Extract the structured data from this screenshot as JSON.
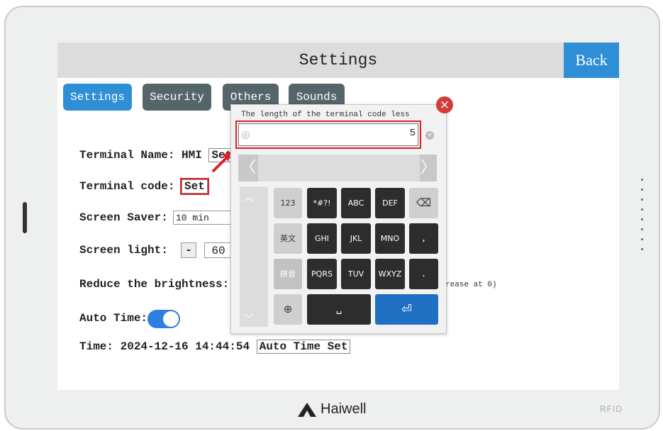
{
  "header": {
    "title": "Settings",
    "back_label": "Back"
  },
  "tabs": [
    {
      "label": "Settings"
    },
    {
      "label": "Security"
    },
    {
      "label": "Others"
    },
    {
      "label": "Sounds"
    }
  ],
  "form": {
    "terminal_name_label": "Terminal Name: HMI",
    "terminal_name_btn": "Set",
    "terminal_code_label": "Terminal code:",
    "terminal_code_btn": "Set",
    "screen_saver_label": "Screen Saver:",
    "screen_saver_value": "10 min",
    "screen_light_label": "Screen light:",
    "minus_label": "-",
    "screen_light_value": "60",
    "reduce_label": "Reduce the brightness:",
    "reduce_hint": "rease at 0)",
    "auto_time_label": "Auto Time:",
    "auto_time_on": true,
    "time_label": "Time: 2024-12-16 14:44:54",
    "auto_time_set_btn": "Auto Time Set"
  },
  "keyboard": {
    "hint": "The length of the terminal code less",
    "close_icon": "×",
    "eye_icon": "◎",
    "input_value": "5",
    "clear_icon": "×",
    "prev_icon": "〈",
    "next_icon": "〉",
    "scroll_up_icon": "︿",
    "scroll_down_icon": "﹀",
    "keys": {
      "k123": "123",
      "sym": "*#?!",
      "abc": "ABC",
      "def": "DEF",
      "backspace": "⌫",
      "lang": "英文",
      "ghi": "GHI",
      "jkl": "JKL",
      "mno": "MNO",
      "comma": ",",
      "pinyin": "拼音",
      "pqrs": "PQRS",
      "tuv": "TUV",
      "wxyz": "WXYZ",
      "period": ".",
      "globe": "⊕",
      "space": "␣",
      "enter": "⏎"
    }
  },
  "brand": {
    "name": "Haiwell",
    "rfid": "RFID"
  },
  "colors": {
    "accent": "#2f8fd6",
    "tab_inactive": "#55666b",
    "highlight_red": "#e0202a",
    "enter_key": "#1f6fc2"
  }
}
